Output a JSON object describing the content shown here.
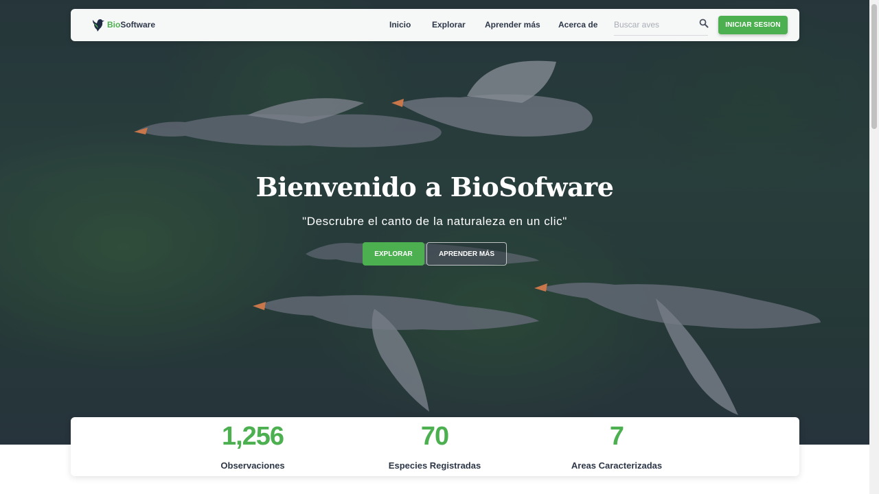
{
  "brand": {
    "prefix": "Bio",
    "suffix": "Software"
  },
  "nav": {
    "links": [
      "Inicio",
      "Explorar",
      "Aprender más",
      "Acerca de"
    ],
    "search_placeholder": "Buscar aves",
    "login_label": "INICIAR SESION"
  },
  "hero": {
    "title": "Bienvenido a BioSofware",
    "subtitle": "\"Descrubre el canto de la naturaleza en un clic\"",
    "explore_label": "EXPLORAR",
    "learn_label": "APRENDER MÁS"
  },
  "stats": [
    {
      "value": "1,256",
      "label": "Observaciones"
    },
    {
      "value": "70",
      "label": "Especies Registradas"
    },
    {
      "value": "7",
      "label": "Areas Caracterizadas"
    }
  ],
  "colors": {
    "accent": "#4caf50",
    "text_dark": "#2d3748"
  }
}
